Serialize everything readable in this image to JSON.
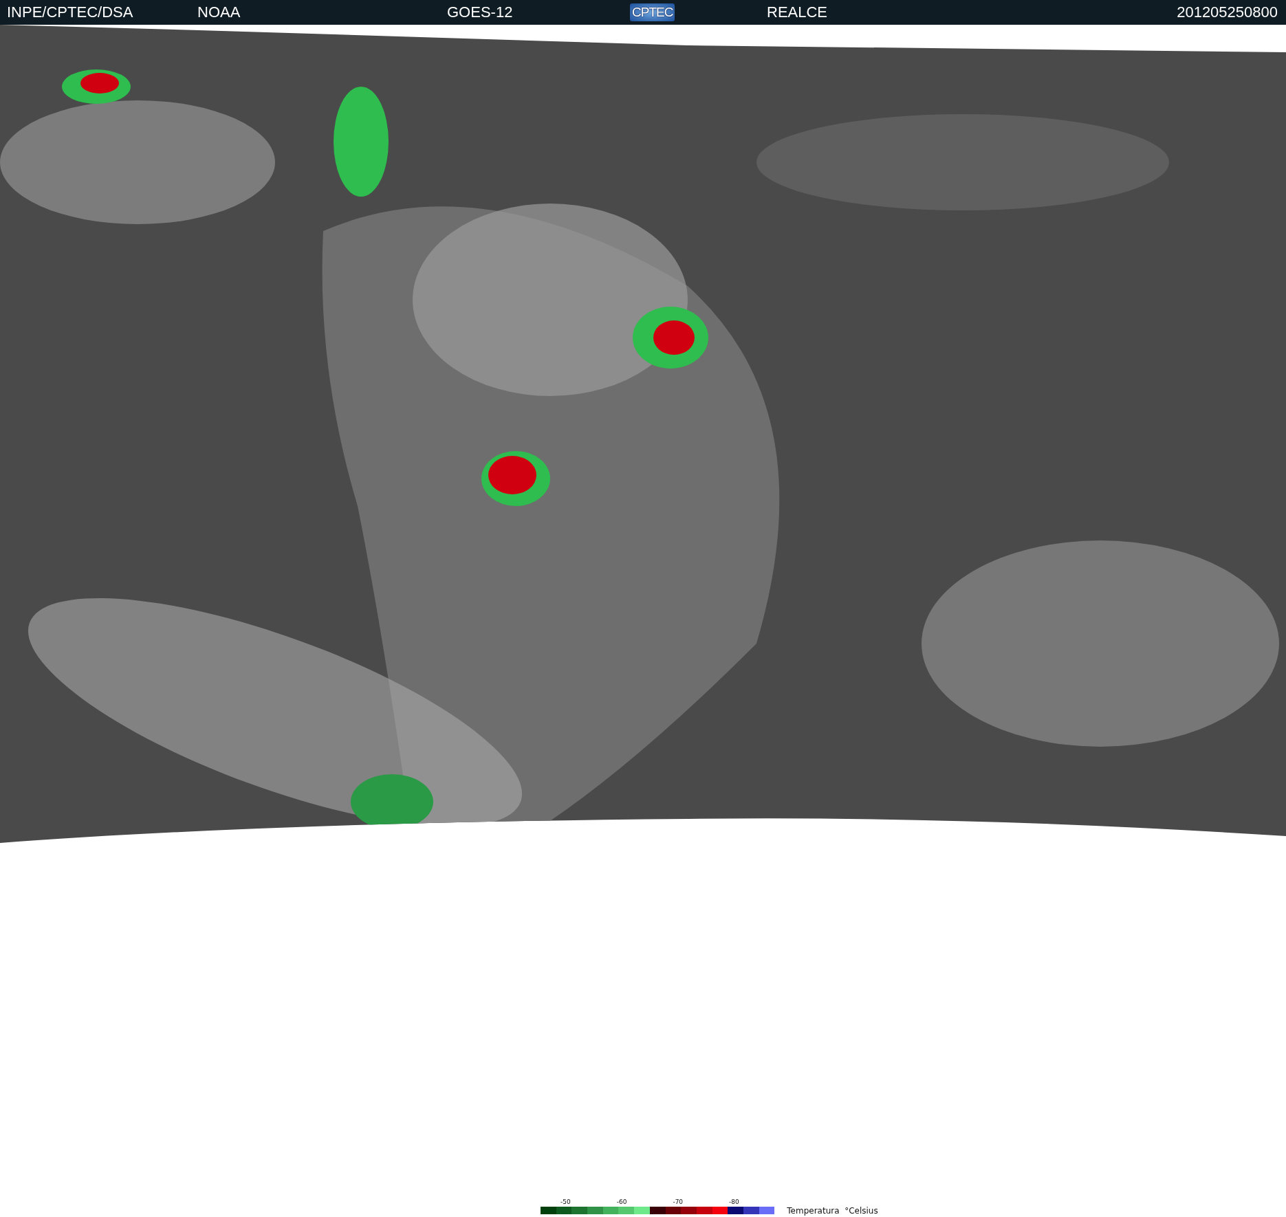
{
  "header": {
    "items": [
      {
        "kind": "text",
        "text": "INPE/CPTEC/DSA"
      },
      {
        "kind": "text",
        "text": "NOAA"
      },
      {
        "kind": "text",
        "text": "GOES-12"
      },
      {
        "kind": "logo",
        "text": "CPTEC"
      },
      {
        "kind": "text",
        "text": "REALCE"
      },
      {
        "kind": "text",
        "text": "201205250800"
      }
    ]
  },
  "legend": {
    "title": "Temperatura  °Celsius",
    "ticks": [
      "-50",
      "-60",
      "-70",
      "-80"
    ],
    "swatches": [
      {
        "color": "#00400d"
      },
      {
        "color": "#0f5a1f"
      },
      {
        "color": "#1d7430"
      },
      {
        "color": "#2f9246"
      },
      {
        "color": "#44b25c"
      },
      {
        "color": "#55c86f"
      },
      {
        "color": "#6fe98a"
      },
      {
        "color": "#3a0007"
      },
      {
        "color": "#6a0008"
      },
      {
        "color": "#95000b"
      },
      {
        "color": "#c6000d"
      },
      {
        "color": "#f5000f"
      },
      {
        "color": "#0b0a72"
      },
      {
        "color": "#3435b8"
      },
      {
        "color": "#6a6df7"
      }
    ]
  }
}
